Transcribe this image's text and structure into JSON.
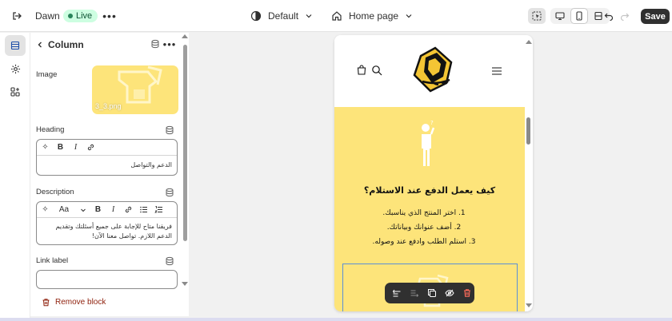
{
  "topbar": {
    "theme_name": "Dawn",
    "live_badge": "Live",
    "device_label": "Default",
    "page_label": "Home page",
    "save_label": "Save"
  },
  "panel": {
    "title": "Column",
    "image": {
      "label": "Image",
      "filename": "3_3.png"
    },
    "heading": {
      "label": "Heading",
      "value": "الدعم والتواصل"
    },
    "description": {
      "label": "Description",
      "value": "فريقنا متاح للإجابة على جميع أسئلتك وتقديم الدعم اللازم. تواصل معنا الآن!"
    },
    "link_label": {
      "label": "Link label",
      "value": ""
    },
    "remove_label": "Remove block",
    "text_style_label": "Aa"
  },
  "preview": {
    "section_title": "كيف يعمل الدفع عند الاستلام؟",
    "steps": [
      "1. اختر المنتج الذي يناسبك.",
      "2. أضف عنوانك وبياناتك.",
      "3. استلم الطلب وادفع عند وصوله."
    ]
  },
  "colors": {
    "accent_dark": "#303030",
    "live_bg": "#cdfee1",
    "live_text": "#0c5132",
    "section_bg": "#fde47a",
    "selection": "#5b8fd6",
    "danger": "#8e1f0b"
  }
}
